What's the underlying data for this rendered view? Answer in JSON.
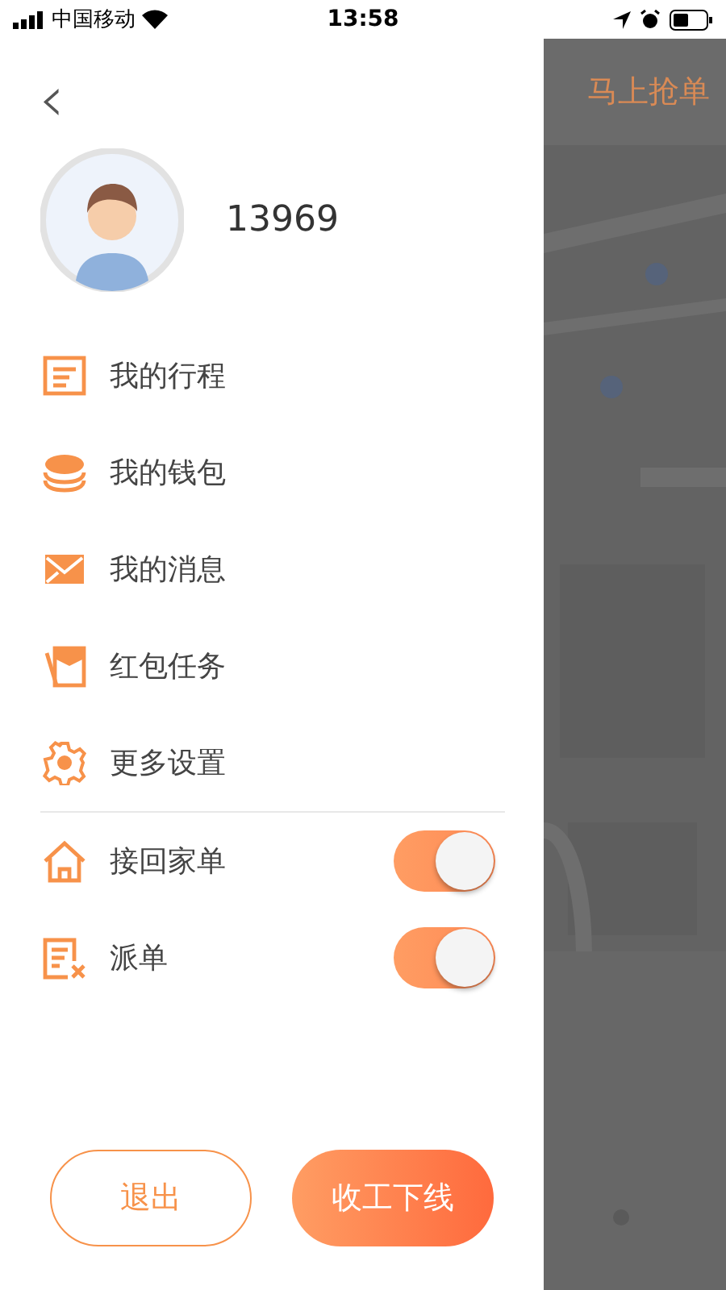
{
  "status_bar": {
    "carrier": "中国移动",
    "time": "13:58"
  },
  "drawer": {
    "back": "‹",
    "user": {
      "name": "13969"
    },
    "menu": [
      {
        "kind": "trip",
        "label": "我的行程"
      },
      {
        "kind": "wallet",
        "label": "我的钱包"
      },
      {
        "kind": "message",
        "label": "我的消息"
      },
      {
        "kind": "redpacket",
        "label": "红包任务"
      },
      {
        "kind": "settings",
        "label": "更多设置"
      }
    ],
    "toggles": [
      {
        "kind": "home",
        "label": "接回家单",
        "on": true
      },
      {
        "kind": "dispatch",
        "label": "派单",
        "on": true
      }
    ],
    "buttons": [
      {
        "kind": "outline",
        "label": "退出"
      },
      {
        "kind": "primary",
        "label": "收工下线"
      }
    ]
  },
  "background": {
    "header_title": "马上抢单"
  }
}
